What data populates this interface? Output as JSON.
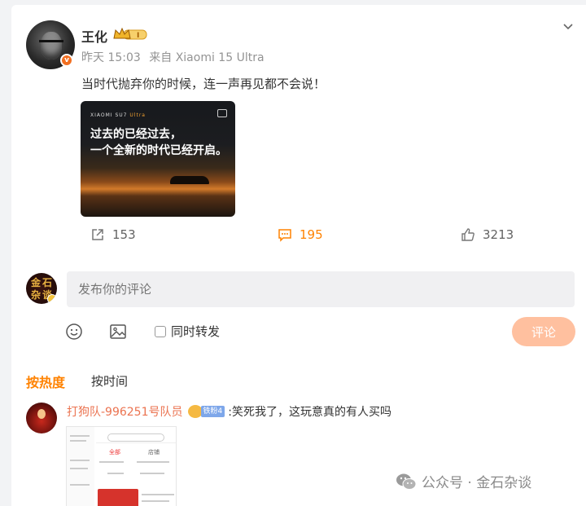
{
  "post": {
    "username": "王化",
    "time": "昨天 15:03",
    "source": "来自 Xiaomi 15 Ultra",
    "text": "当时代抛弃你的时候，连一声再见都不会说！",
    "image": {
      "brand_prefix": "XIAOMI SU7",
      "brand_suffix": "Ultra",
      "line1": "过去的已经过去，",
      "line2": "一个全新的时代已经开启。"
    }
  },
  "actions": {
    "share_count": "153",
    "comment_count": "195",
    "like_count": "3213"
  },
  "composer": {
    "placeholder": "发布你的评论",
    "repost_label": "同时转发",
    "submit_label": "评论"
  },
  "sort": {
    "hot_label": "按热度",
    "time_label": "按时间"
  },
  "comments": [
    {
      "name": "打狗队-996251号队员",
      "fan_tag": "铁粉4",
      "text": ":笑死我了，这玩意真的有人买吗",
      "image": {
        "tab_all": "全部",
        "tab_shop": "店铺"
      }
    }
  ],
  "watermark": "公众号 · 金石杂谈",
  "colors": {
    "accent": "#ff8200",
    "name": "#eb7350",
    "submit_disabled": "#ffc09f"
  }
}
